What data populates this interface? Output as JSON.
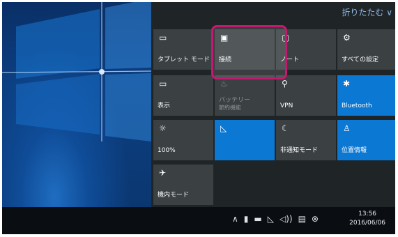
{
  "action_center": {
    "collapse_label": "折りたたむ ∨",
    "tiles": [
      {
        "id": "tablet-mode",
        "icon": "▭",
        "label": "タブレット モード",
        "state": "off"
      },
      {
        "id": "connect",
        "icon": "▣",
        "label": "接続",
        "state": "off"
      },
      {
        "id": "note",
        "icon": "▢",
        "label": "ノート",
        "state": "off"
      },
      {
        "id": "all-settings",
        "icon": "⚙",
        "label": "すべての設定",
        "state": "off"
      },
      {
        "id": "project",
        "icon": "▭",
        "label": "表示",
        "state": "off"
      },
      {
        "id": "battery-saver",
        "icon": "♨",
        "label": "バッテリー",
        "label2": "節約機能",
        "state": "disabled"
      },
      {
        "id": "vpn",
        "icon": "⚲",
        "label": "VPN",
        "state": "off"
      },
      {
        "id": "bluetooth",
        "icon": "✱",
        "label": "Bluetooth",
        "state": "on"
      },
      {
        "id": "brightness",
        "icon": "☼",
        "label": "100%",
        "state": "off"
      },
      {
        "id": "wifi",
        "icon": "◺",
        "label": "",
        "state": "on"
      },
      {
        "id": "quiet-hours",
        "icon": "☾",
        "label": "非通知モード",
        "state": "off"
      },
      {
        "id": "location",
        "icon": "♙",
        "label": "位置情報",
        "state": "on"
      },
      {
        "id": "airplane-mode",
        "icon": "✈",
        "label": "機内モード",
        "state": "off"
      }
    ]
  },
  "taskbar": {
    "tray_icons": [
      "chevron-up-icon",
      "battery-icon",
      "network-icon",
      "wifi-icon",
      "volume-icon",
      "notification-icon",
      "close-icon"
    ],
    "tray_glyphs": [
      "∧",
      "▮",
      "▬",
      "◺",
      "◁))",
      "▤",
      "⊗"
    ],
    "time": "13:56",
    "date": "2016/06/06"
  },
  "colors": {
    "accent": "#0b78d4",
    "tile_off": "#3b4043",
    "highlight_border": "#c21a6e"
  }
}
